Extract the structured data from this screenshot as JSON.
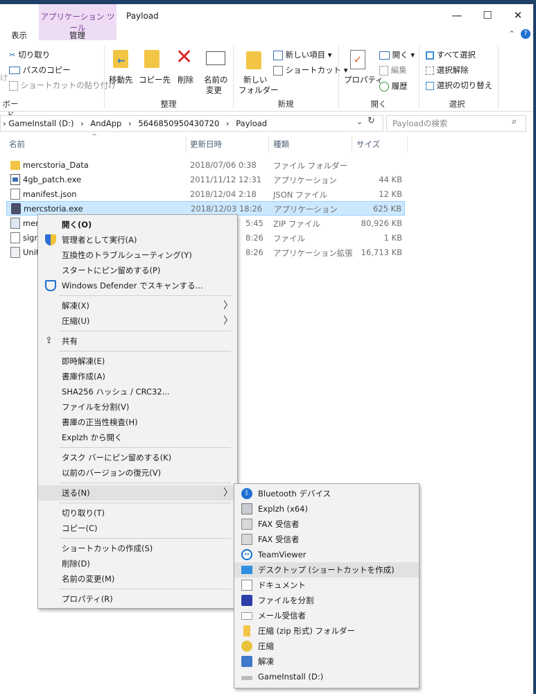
{
  "window": {
    "app_tools_label": "アプリケーション ツール",
    "title": "Payload",
    "minimize": "—",
    "maximize": "☐",
    "close": "✕"
  },
  "tabs": {
    "view": "表示",
    "manage": "管理"
  },
  "ribbon": {
    "cut": "切り取り",
    "copy_path": "パスのコピー",
    "paste_shortcut": "ショートカットの貼り付け",
    "clipboard_group": "ボード",
    "move_to": "移動先",
    "copy_to": "コピー先",
    "delete": "削除",
    "rename_line1": "名前の",
    "rename_line2": "変更",
    "organize_group": "整理",
    "new_folder_line1": "新しい",
    "new_folder_line2": "フォルダー",
    "new_item": "新しい項目",
    "shortcut": "ショートカット",
    "new_group": "新規",
    "properties": "プロパティ",
    "open": "開く",
    "edit": "編集",
    "history": "履歴",
    "open_group": "開く",
    "select_all": "すべて選択",
    "select_none": "選択解除",
    "invert_selection": "選択の切り替え",
    "select_group": "選択",
    "left_edge_char": "け"
  },
  "address": {
    "path": [
      "GameInstall (D:)",
      "AndApp",
      "5646850950430720",
      "Payload"
    ],
    "search_placeholder": "Payloadの検索"
  },
  "columns": {
    "name": "名前",
    "modified": "更新日時",
    "type": "種類",
    "size": "サイズ"
  },
  "files": [
    {
      "name": "mercstoria_Data",
      "date": "2018/07/06 0:38",
      "type": "ファイル フォルダー",
      "size": "",
      "icon": "folder-icon"
    },
    {
      "name": "4gb_patch.exe",
      "date": "2011/11/12 12:31",
      "type": "アプリケーション",
      "size": "44 KB",
      "icon": "app-icon"
    },
    {
      "name": "manifest.json",
      "date": "2018/12/04 2:18",
      "type": "JSON ファイル",
      "size": "12 KB",
      "icon": "file-icon"
    },
    {
      "name": "mercstoria.exe",
      "date": "2018/12/03 18:26",
      "type": "アプリケーション",
      "size": "625 KB",
      "icon": "game-icon"
    },
    {
      "name": "mer",
      "date": "5:45",
      "type": "ZIP ファイル",
      "size": "80,926 KB",
      "icon": "zip-icon"
    },
    {
      "name": "sign",
      "date": "8:26",
      "type": "ファイル",
      "size": "1 KB",
      "icon": "file-icon"
    },
    {
      "name": "Unit",
      "date": "8:26",
      "type": "アプリケーション拡張",
      "size": "16,713 KB",
      "icon": "dll-icon"
    }
  ],
  "context_menu": {
    "open": "開く(O)",
    "run_as_admin": "管理者として実行(A)",
    "troubleshoot": "互換性のトラブルシューティング(Y)",
    "pin_start": "スタートにピン留めする(P)",
    "defender": "Windows Defender でスキャンする...",
    "extract": "解凍(X)",
    "compress": "圧縮(U)",
    "share": "共有",
    "instant_extract": "即時解凍(E)",
    "create_archive": "書庫作成(A)",
    "sha256": "SHA256 ハッシュ / CRC32...",
    "split_file": "ファイルを分割(V)",
    "verify_archive": "書庫の正当性検査(H)",
    "open_explzh": "Explzh から開く",
    "pin_taskbar": "タスク バーにピン留めする(K)",
    "restore_versions": "以前のバージョンの復元(V)",
    "send_to": "送る(N)",
    "cut": "切り取り(T)",
    "copy": "コピー(C)",
    "create_shortcut": "ショートカットの作成(S)",
    "delete": "削除(D)",
    "rename": "名前の変更(M)",
    "properties": "プロパティ(R)"
  },
  "send_to_menu": [
    {
      "label": "Bluetooth デバイス",
      "icon": "bluetooth-icon"
    },
    {
      "label": "Explzh (x64)",
      "icon": "explzh-icon"
    },
    {
      "label": "FAX 受信者",
      "icon": "fax-icon"
    },
    {
      "label": "FAX 受信者",
      "icon": "fax-icon"
    },
    {
      "label": "TeamViewer",
      "icon": "teamviewer-icon"
    },
    {
      "label": "デスクトップ (ショートカットを作成)",
      "icon": "desktop-icon"
    },
    {
      "label": "ドキュメント",
      "icon": "documents-icon"
    },
    {
      "label": "ファイルを分割",
      "icon": "split-file-icon"
    },
    {
      "label": "メール受信者",
      "icon": "mail-icon"
    },
    {
      "label": "圧縮 (zip 形式) フォルダー",
      "icon": "zip-folder-icon"
    },
    {
      "label": "圧縮",
      "icon": "compress-icon"
    },
    {
      "label": "解凍",
      "icon": "extract-icon"
    },
    {
      "label": "GameInstall (D:)",
      "icon": "drive-icon"
    }
  ],
  "colors": {
    "selection": "#cce8ff",
    "accent": "#0078d7",
    "app_tools": "#eedcf5"
  }
}
